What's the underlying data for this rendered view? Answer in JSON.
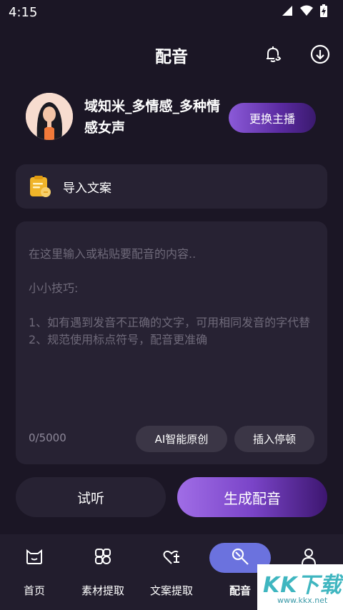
{
  "status_bar": {
    "time": "4:15"
  },
  "header": {
    "title": "配音"
  },
  "anchor": {
    "name": "域知米_多情感_多种情感女声",
    "change_label": "更换主播"
  },
  "import": {
    "label": "导入文案"
  },
  "editor": {
    "placeholder": "在这里输入或粘贴要配音的内容..\n\n小小技巧:\n\n1、如有遇到发音不正确的文字，可用相同发音的字代替\n2、规范使用标点符号，配音更准确",
    "char_count": "0/5000",
    "ai_label": "AI智能原创",
    "pause_label": "插入停顿"
  },
  "actions": {
    "listen_label": "试听",
    "generate_label": "生成配音"
  },
  "tabs": [
    {
      "label": "首页",
      "icon": "home-icon"
    },
    {
      "label": "素材提取",
      "icon": "material-icon"
    },
    {
      "label": "文案提取",
      "icon": "text-extract-icon"
    },
    {
      "label": "配音",
      "icon": "dubbing-icon",
      "active": true
    },
    {
      "label": "",
      "icon": "profile-icon"
    }
  ],
  "watermark": {
    "text": "KK下载",
    "url": "www.kkx.net"
  },
  "colors": {
    "background": "#1b1625",
    "card": "#272233",
    "accent": "#8b5ad8",
    "active_tab": "#6b72de"
  }
}
